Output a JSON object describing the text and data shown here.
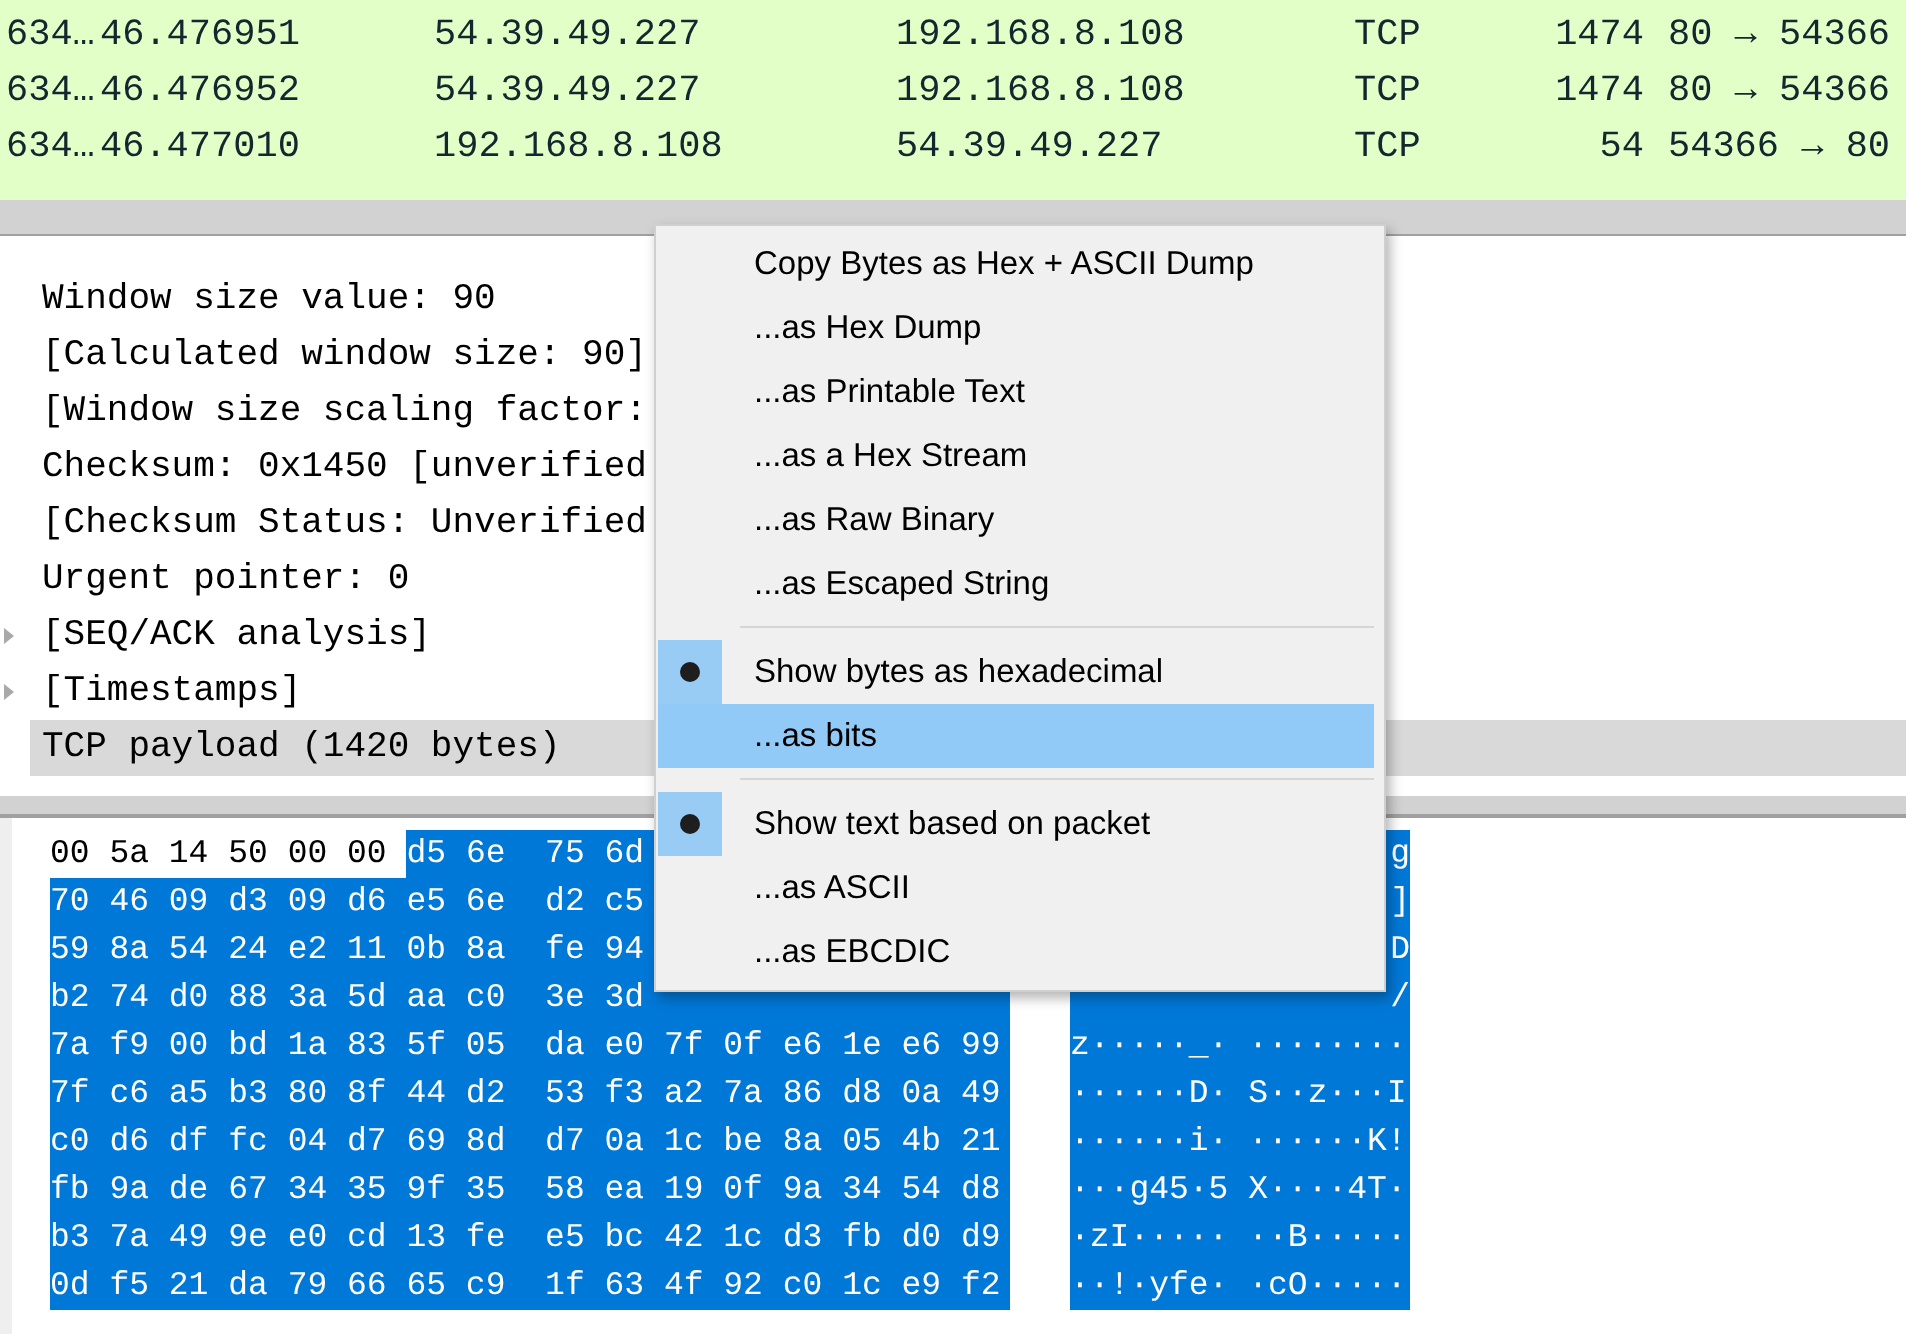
{
  "packet_list": {
    "rows": [
      {
        "no": "634…",
        "time": "46.476951",
        "source": "54.39.49.227",
        "destination": "192.168.8.108",
        "protocol": "TCP",
        "length": "1474",
        "info": "80 → 54366"
      },
      {
        "no": "634…",
        "time": "46.476952",
        "source": "54.39.49.227",
        "destination": "192.168.8.108",
        "protocol": "TCP",
        "length": "1474",
        "info": "80 → 54366"
      },
      {
        "no": "634…",
        "time": "46.477010",
        "source": "192.168.8.108",
        "destination": "54.39.49.227",
        "protocol": "TCP",
        "length": "54",
        "info": "54366 → 80"
      }
    ]
  },
  "details": {
    "items": [
      {
        "text": "Window size value: 90",
        "expandable": false,
        "selected": false
      },
      {
        "text": "[Calculated window size: 90]",
        "expandable": false,
        "selected": false
      },
      {
        "text": "[Window size scaling factor:",
        "expandable": false,
        "selected": false
      },
      {
        "text": "Checksum: 0x1450 [unverified",
        "expandable": false,
        "selected": false
      },
      {
        "text": "[Checksum Status: Unverified",
        "expandable": false,
        "selected": false
      },
      {
        "text": "Urgent pointer: 0",
        "expandable": false,
        "selected": false
      },
      {
        "text": "[SEQ/ACK analysis]",
        "expandable": true,
        "selected": false
      },
      {
        "text": "[Timestamps]",
        "expandable": true,
        "selected": false
      },
      {
        "text": "TCP payload (1420 bytes)",
        "expandable": false,
        "selected": true
      }
    ]
  },
  "hex_dump": {
    "rows": [
      {
        "segments": [
          {
            "text": "00 5a 14 50 00 00 ",
            "selected": false
          },
          {
            "text": "d5 6e  75 6d",
            "selected": true
          }
        ],
        "ascii": "g"
      },
      {
        "segments": [
          {
            "text": "70 46 09 d3 09 d6 e5 6e  d2 c5",
            "selected": true
          }
        ],
        "ascii": "]"
      },
      {
        "segments": [
          {
            "text": "59 8a 54 24 e2 11 0b 8a  fe 94",
            "selected": true
          }
        ],
        "ascii": "D"
      },
      {
        "segments": [
          {
            "text": "b2 74 d0 88 3a 5d aa c0  3e 3d",
            "selected": true
          }
        ],
        "ascii": "/"
      },
      {
        "segments": [
          {
            "text": "7a f9 00 bd 1a 83 5f 05  da e0 7f 0f e6 1e e6 99",
            "selected": true
          }
        ],
        "ascii": "z·····_· ········"
      },
      {
        "segments": [
          {
            "text": "7f c6 a5 b3 80 8f 44 d2  53 f3 a2 7a 86 d8 0a 49",
            "selected": true
          }
        ],
        "ascii": "······D· S··z···I"
      },
      {
        "segments": [
          {
            "text": "c0 d6 df fc 04 d7 69 8d  d7 0a 1c be 8a 05 4b 21",
            "selected": true
          }
        ],
        "ascii": "······i· ······K!"
      },
      {
        "segments": [
          {
            "text": "fb 9a de 67 34 35 9f 35  58 ea 19 0f 9a 34 54 d8",
            "selected": true
          }
        ],
        "ascii": "···g45·5 X····4T·"
      },
      {
        "segments": [
          {
            "text": "b3 7a 49 9e e0 cd 13 fe  e5 bc 42 1c d3 fb d0 d9",
            "selected": true
          }
        ],
        "ascii": "·zI····· ··B·····"
      },
      {
        "segments": [
          {
            "text": "0d f5 21 da 79 66 65 c9  1f 63 4f 92 c0 1c e9 f2",
            "selected": true
          }
        ],
        "ascii": "··!·yfe· ·cO·····"
      }
    ]
  },
  "context_menu": {
    "items": [
      {
        "kind": "action",
        "label": "Copy Bytes as Hex + ASCII Dump",
        "selected": false
      },
      {
        "kind": "action",
        "label": "...as Hex Dump",
        "selected": false
      },
      {
        "kind": "action",
        "label": "...as Printable Text",
        "selected": false
      },
      {
        "kind": "action",
        "label": "...as a Hex Stream",
        "selected": false
      },
      {
        "kind": "action",
        "label": "...as Raw Binary",
        "selected": false
      },
      {
        "kind": "action",
        "label": "...as Escaped String",
        "selected": false
      },
      {
        "kind": "separator"
      },
      {
        "kind": "radio",
        "label": "Show bytes as hexadecimal",
        "checked": true,
        "selected": false
      },
      {
        "kind": "radio",
        "label": "...as bits",
        "checked": false,
        "selected": true
      },
      {
        "kind": "separator"
      },
      {
        "kind": "radio",
        "label": "Show text based on packet",
        "checked": true,
        "selected": false
      },
      {
        "kind": "radio",
        "label": "...as ASCII",
        "checked": false,
        "selected": false
      },
      {
        "kind": "radio",
        "label": "...as EBCDIC",
        "checked": false,
        "selected": false
      }
    ]
  }
}
